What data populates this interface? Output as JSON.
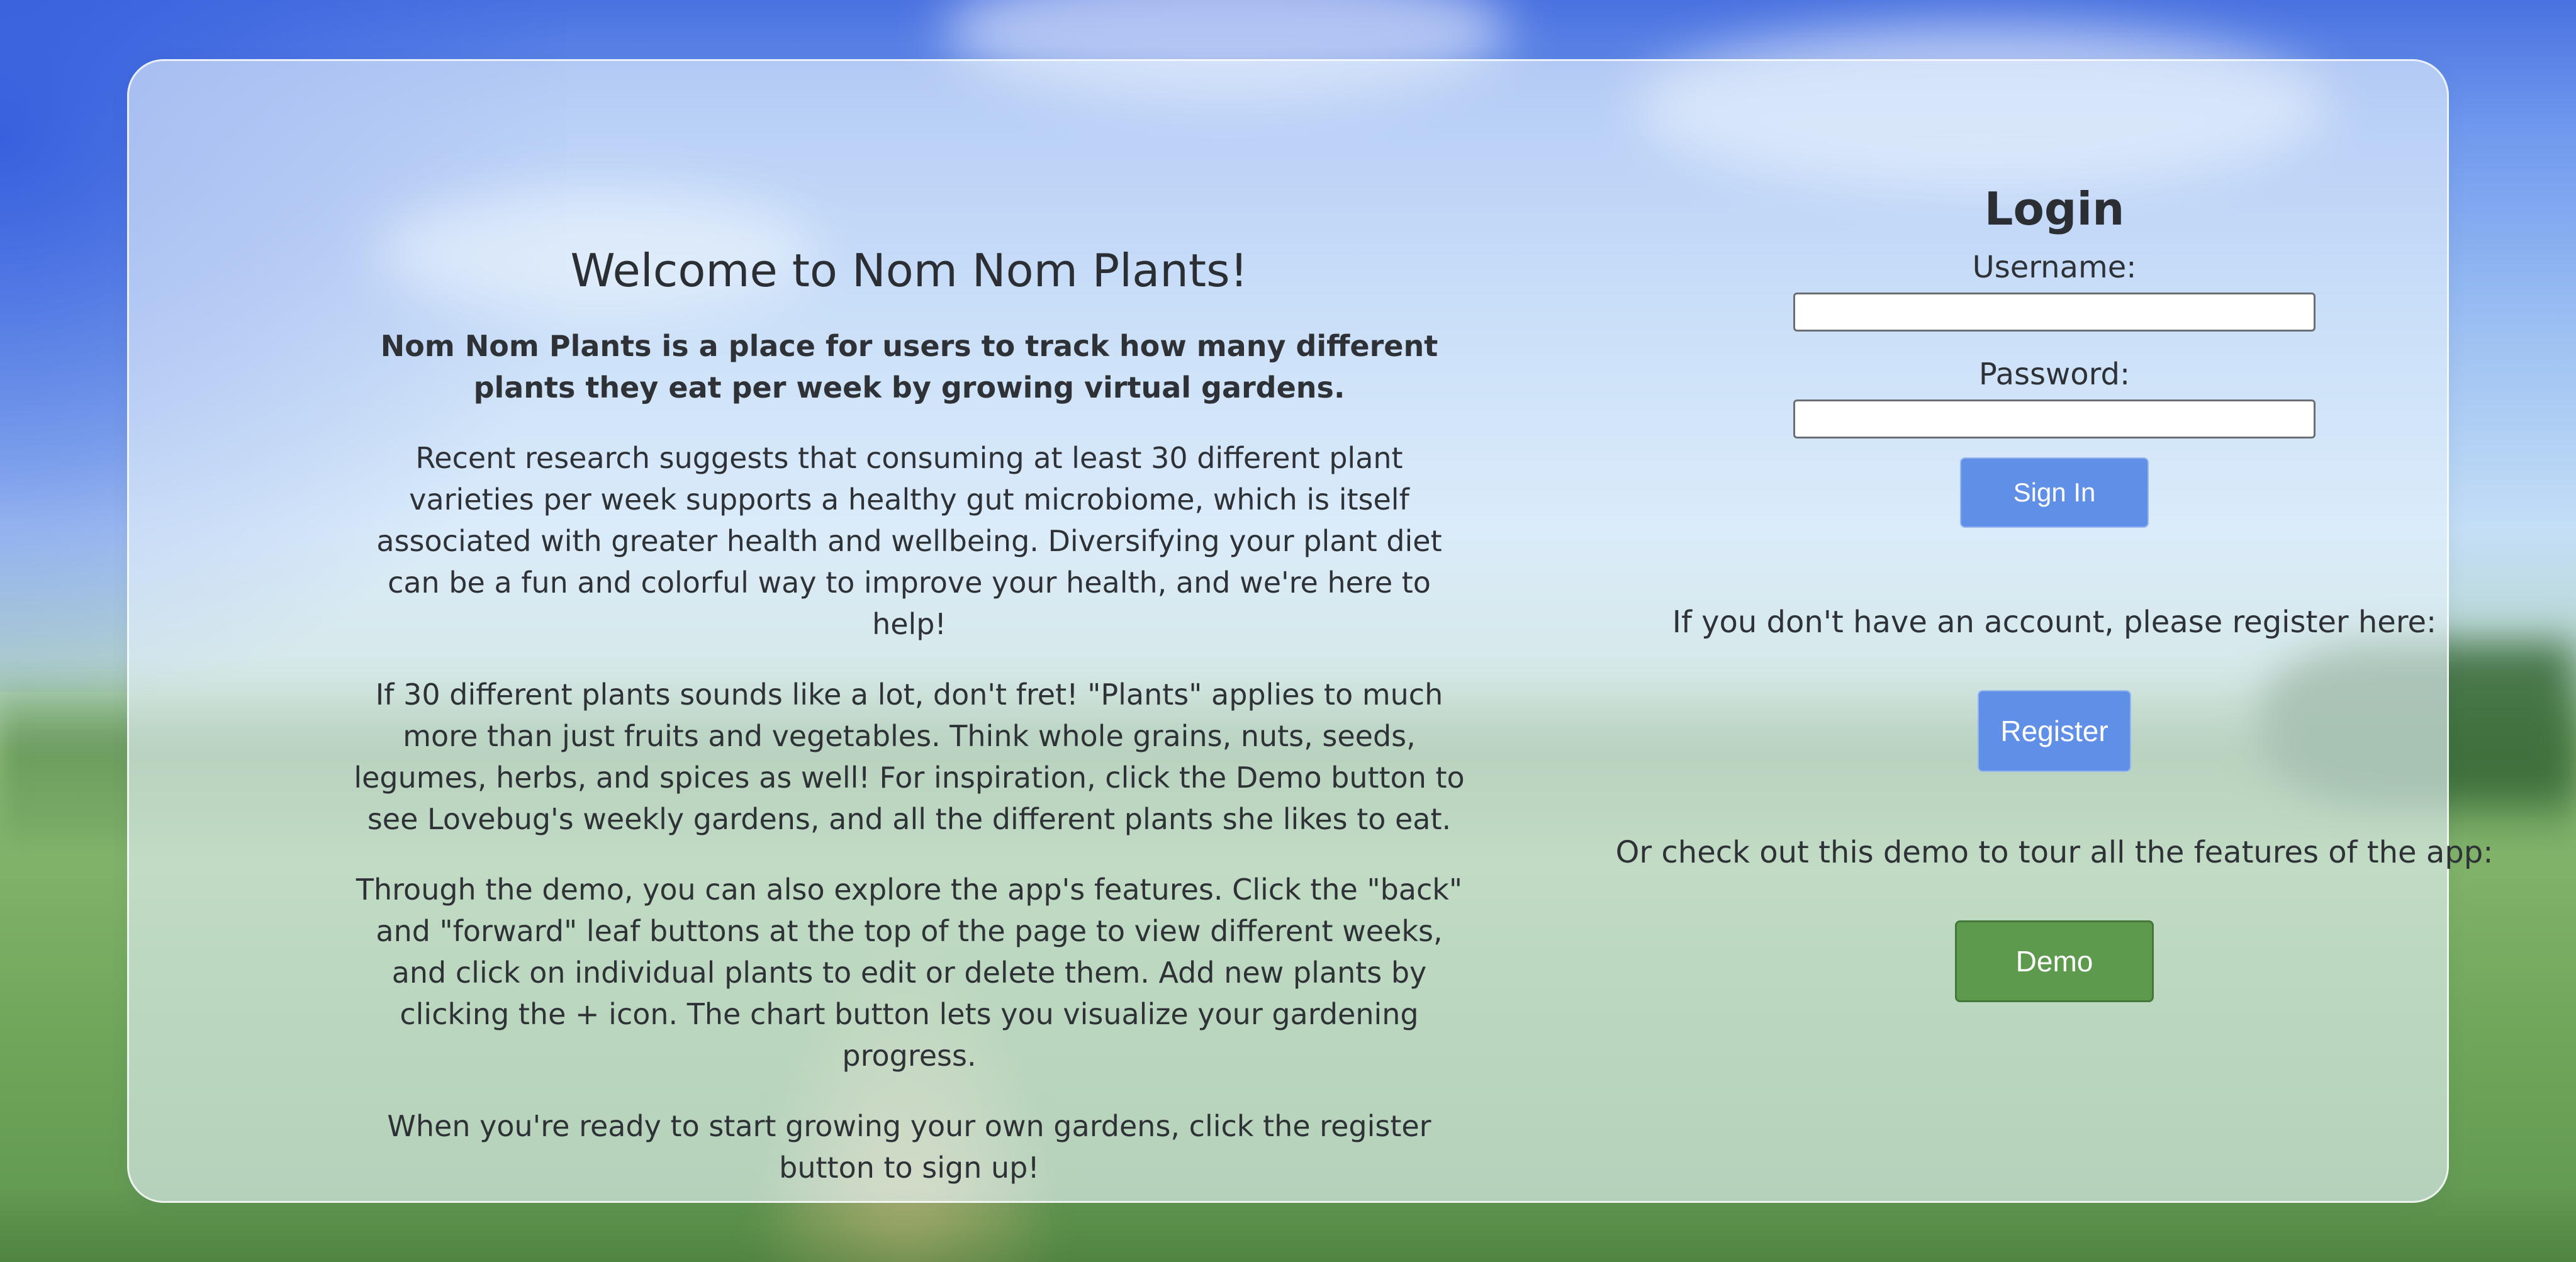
{
  "welcome": {
    "title": "Welcome to Nom Nom Plants!",
    "paragraphs": [
      "Nom Nom Plants is a place for users to track how many different plants they eat per week by growing virtual gardens.",
      "Recent research suggests that consuming at least 30 different plant varieties per week supports a healthy gut microbiome, which is itself associated with greater health and wellbeing. Diversifying your plant diet can be a fun and colorful way to improve your health, and we're here to help!",
      "If 30 different plants sounds like a lot, don't fret! \"Plants\" applies to much more than just fruits and vegetables. Think whole grains, nuts, seeds, legumes, herbs, and spices as well! For inspiration, click the Demo button to see Lovebug's weekly gardens, and all the different plants she likes to eat.",
      "Through the demo, you can also explore the app's features. Click the \"back\" and \"forward\" leaf buttons at the top of the page to view different weeks, and click on individual plants to edit or delete them. Add new plants by clicking the + icon. The chart button lets you visualize your gardening progress.",
      "When you're ready to start growing your own gardens, click the register button to sign up!"
    ]
  },
  "login": {
    "title": "Login",
    "username_label": "Username:",
    "username_value": "",
    "password_label": "Password:",
    "password_value": "",
    "sign_in_label": "Sign In"
  },
  "register": {
    "prompt": "If you don't have an account, please register here:",
    "button_label": "Register"
  },
  "demo": {
    "prompt": "Or check out this demo to tour all the features of the app:",
    "button_label": "Demo"
  },
  "colors": {
    "primary_button": "#5f8fe6",
    "demo_button": "#5e9a4d",
    "text": "#2e3236"
  }
}
